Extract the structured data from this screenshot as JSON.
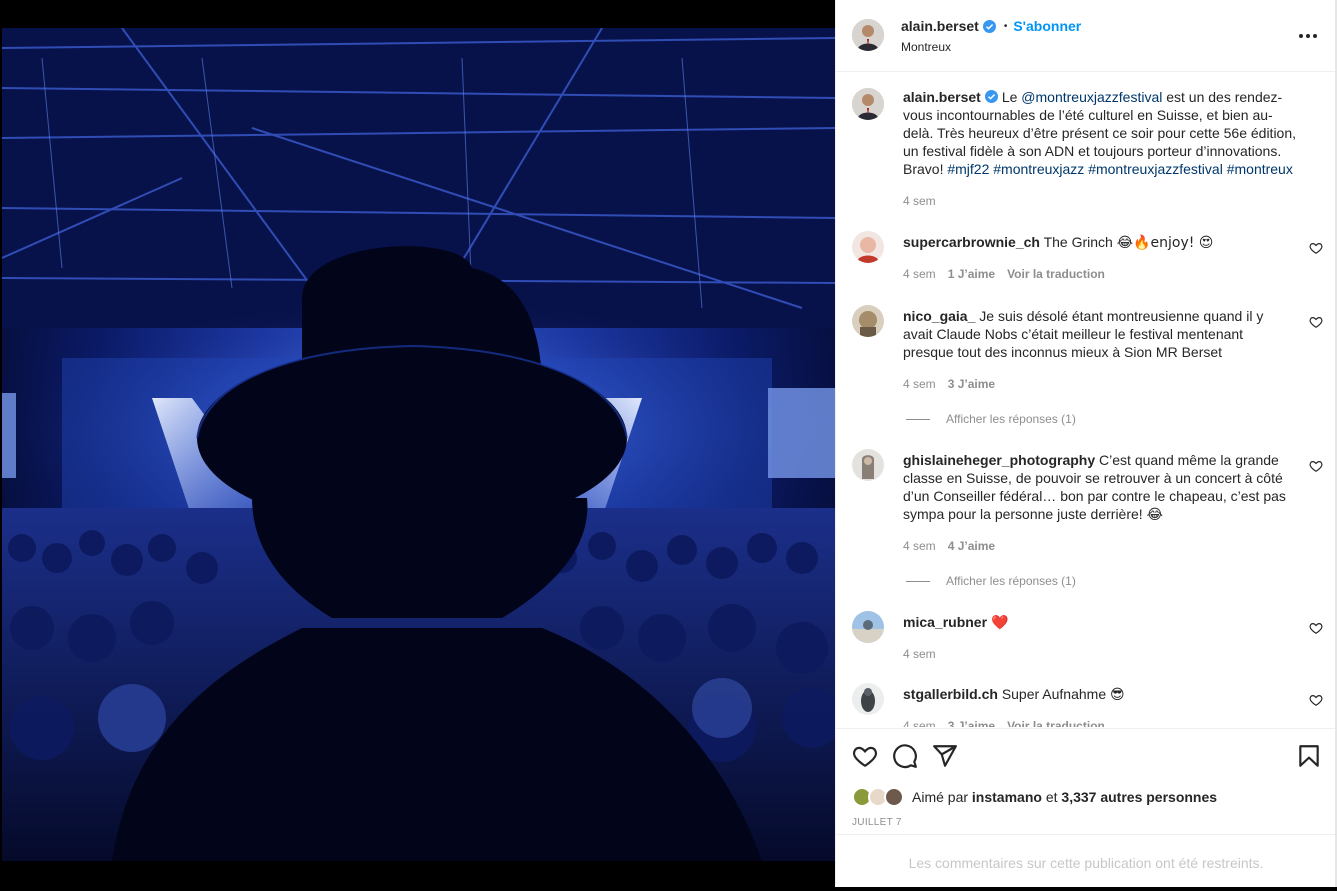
{
  "post": {
    "author": "alain.berset",
    "follow_label": "S'abonner",
    "location": "Montreux",
    "separator": "•"
  },
  "caption": {
    "author": "alain.berset",
    "text_before": "Le ",
    "mention": "@montreuxjazzfestival",
    "text_after": " est un des rendez-vous incontournables de l’été culturel en Suisse, et bien au-delà. Très heureux d’être présent ce soir pour cette 56e édition, un festival fidèle à son ADN et toujours porteur d’innovations. Bravo!",
    "hashtags": "#mjf22 #montreuxjazz #montreuxjazzfestival #montreux",
    "time": "4 sem"
  },
  "comments": [
    {
      "user": "supercarbrownie_ch",
      "text": "The Grinch",
      "emoji": "😂🔥enjoy! 😍",
      "time": "4 sem",
      "likes": "1 J’aime",
      "translate": "Voir la traduction",
      "replies": ""
    },
    {
      "user": "nico_gaia_",
      "text": "Je suis désolé étant montreusienne quand il y avait Claude Nobs c’était meilleur le festival mentenant presque tout des inconnus mieux à Sion MR Berset",
      "emoji": "",
      "time": "4 sem",
      "likes": "3 J’aime",
      "translate": "",
      "replies": "Afficher les réponses (1)"
    },
    {
      "user": "ghislaineheger_photography",
      "text": "C’est quand même la grande classe en Suisse, de pouvoir se retrouver à un concert à côté d’un Conseiller fédéral… bon par contre le chapeau, c’est pas sympa pour la personne juste derrière!",
      "emoji": "😂",
      "time": "4 sem",
      "likes": "4 J’aime",
      "translate": "",
      "replies": "Afficher les réponses (1)"
    },
    {
      "user": "mica_rubner",
      "text": "",
      "emoji": "❤️",
      "time": "4 sem",
      "likes": "",
      "translate": "",
      "replies": ""
    },
    {
      "user": "stgallerbild.ch",
      "text": "Super Aufnahme",
      "emoji": "😎",
      "time": "4 sem",
      "likes": "3 J’aime",
      "translate": "Voir la traduction",
      "replies": ""
    }
  ],
  "likes": {
    "prefix": "Aimé par",
    "first": "instamano",
    "conj": "et",
    "others": "3,337 autres personnes"
  },
  "date": "JUILLET 7",
  "restricted": "Les commentaires sur cette publication ont été restreints.",
  "icons": {
    "like": "heart-icon",
    "comment": "comment-icon",
    "share": "paper-plane-icon",
    "save": "bookmark-icon",
    "more": "more-horizontal-icon",
    "verified": "verified-badge-icon"
  },
  "colors": {
    "follow": "#0095f6",
    "mention": "#00376b",
    "muted": "#8e8e8e",
    "verified": "#3897f0"
  }
}
